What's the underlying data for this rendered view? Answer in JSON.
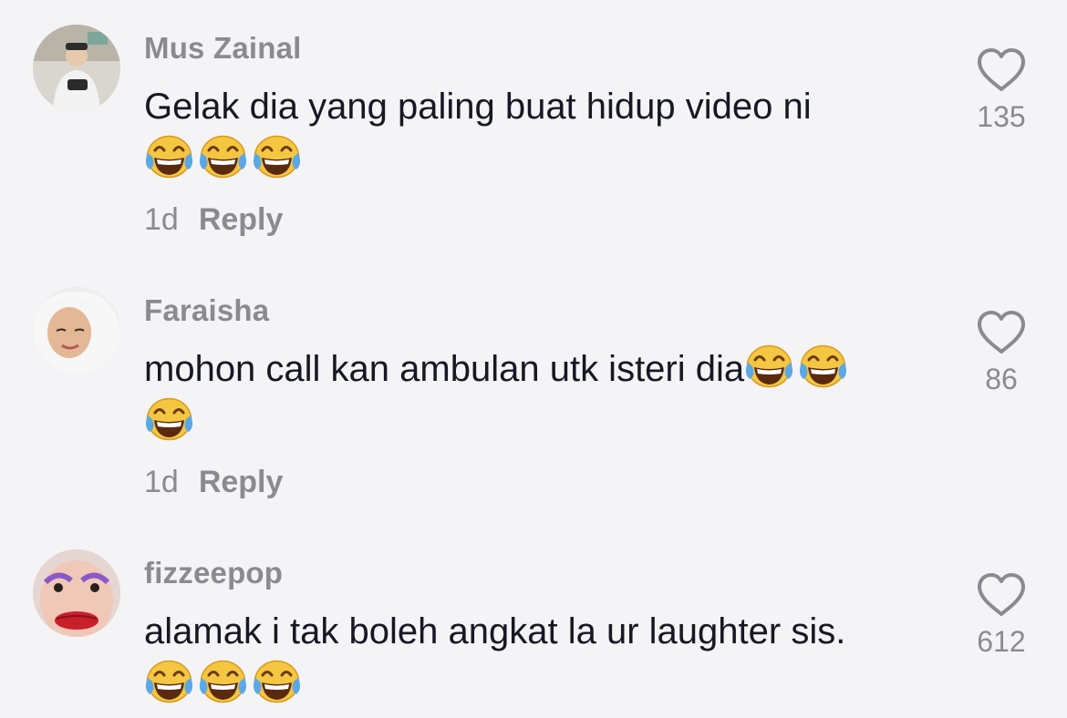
{
  "comments": [
    {
      "username": "Mus Zainal",
      "text": "Gelak dia yang paling buat hidup video ni",
      "emoji_line1": [],
      "emoji_line2": [
        "tears-of-joy",
        "tears-of-joy",
        "tears-of-joy"
      ],
      "time": "1d",
      "reply_label": "Reply",
      "likes": "135"
    },
    {
      "username": "Faraisha",
      "text": "mohon call kan ambulan utk isteri dia",
      "emoji_line1": [
        "tears-of-joy",
        "tears-of-joy"
      ],
      "emoji_line2": [
        "tears-of-joy"
      ],
      "time": "1d",
      "reply_label": "Reply",
      "likes": "86"
    },
    {
      "username": "fizzeepop",
      "text": "alamak i tak boleh angkat la ur laughter sis.",
      "emoji_line1": [],
      "emoji_line2": [
        "tears-of-joy",
        "tears-of-joy",
        "tears-of-joy"
      ],
      "likes": "612"
    }
  ],
  "colors": {
    "background": "#f4f4f6",
    "text": "#161823",
    "secondary": "#8a8b91"
  }
}
